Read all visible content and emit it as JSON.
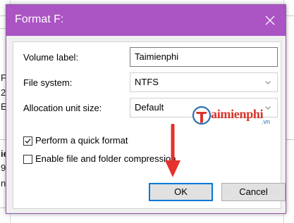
{
  "background": {
    "left_fragments": [
      "F",
      "2",
      "E",
      "ie",
      "9",
      "ny"
    ]
  },
  "dialog": {
    "title": "Format F:",
    "volume_label": {
      "label": "Volume label:",
      "value": "Taimienphi"
    },
    "file_system": {
      "label": "File system:",
      "selected": "NTFS"
    },
    "allocation_unit_size": {
      "label": "Allocation unit size:",
      "selected": "Default"
    },
    "quick_format": {
      "label": "Perform a quick format",
      "checked": true
    },
    "compression": {
      "label": "Enable file and folder compression",
      "checked": false
    },
    "ok_label": "OK",
    "cancel_label": "Cancel"
  },
  "watermark": {
    "text": "aimienphi",
    "tld": ".vn"
  },
  "colors": {
    "titlebar": "#ab54c4",
    "arrow": "#e5322d",
    "focus_border": "#0078d7"
  }
}
